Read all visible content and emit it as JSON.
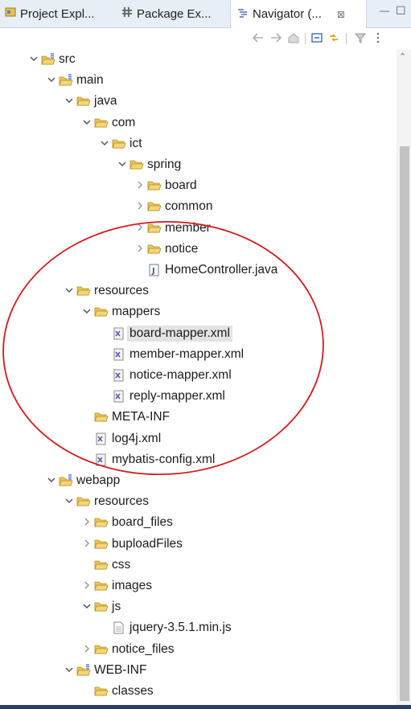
{
  "tabs": [
    {
      "label": "Project Expl...",
      "icon": "project-explorer-icon"
    },
    {
      "label": "Package Ex...",
      "icon": "package-explorer-icon"
    },
    {
      "label": "Navigator (...",
      "icon": "navigator-icon",
      "close": "⊠"
    }
  ],
  "window_controls": {
    "minimize": "—",
    "maximize": "☐"
  },
  "toolbar": [
    "back-icon",
    "forward-icon",
    "home-icon",
    "collapse-all-icon",
    "link-editor-icon",
    "filter-icon",
    "view-menu-icon"
  ],
  "tree": [
    {
      "label": "src",
      "type": "src-folder",
      "depth": 0,
      "twisty": "v"
    },
    {
      "label": "main",
      "type": "src-folder",
      "depth": 1,
      "twisty": "v"
    },
    {
      "label": "java",
      "type": "folder",
      "depth": 2,
      "twisty": "v"
    },
    {
      "label": "com",
      "type": "folder",
      "depth": 3,
      "twisty": "v"
    },
    {
      "label": "ict",
      "type": "folder",
      "depth": 4,
      "twisty": "v"
    },
    {
      "label": "spring",
      "type": "folder",
      "depth": 5,
      "twisty": "v"
    },
    {
      "label": "board",
      "type": "folder",
      "depth": 6,
      "twisty": ">"
    },
    {
      "label": "common",
      "type": "folder",
      "depth": 6,
      "twisty": ">"
    },
    {
      "label": "member",
      "type": "folder",
      "depth": 6,
      "twisty": ">"
    },
    {
      "label": "notice",
      "type": "folder",
      "depth": 6,
      "twisty": ">"
    },
    {
      "label": "HomeController.java",
      "type": "java",
      "depth": 6,
      "twisty": ""
    },
    {
      "label": "resources",
      "type": "folder",
      "depth": 2,
      "twisty": "v"
    },
    {
      "label": "mappers",
      "type": "folder",
      "depth": 3,
      "twisty": "v"
    },
    {
      "label": "board-mapper.xml",
      "type": "xml",
      "depth": 4,
      "twisty": "",
      "selected": true
    },
    {
      "label": "member-mapper.xml",
      "type": "xml",
      "depth": 4,
      "twisty": ""
    },
    {
      "label": "notice-mapper.xml",
      "type": "xml",
      "depth": 4,
      "twisty": ""
    },
    {
      "label": "reply-mapper.xml",
      "type": "xml",
      "depth": 4,
      "twisty": ""
    },
    {
      "label": "META-INF",
      "type": "folder",
      "depth": 3,
      "twisty": ""
    },
    {
      "label": "log4j.xml",
      "type": "xml",
      "depth": 3,
      "twisty": ""
    },
    {
      "label": "mybatis-config.xml",
      "type": "xml",
      "depth": 3,
      "twisty": ""
    },
    {
      "label": "webapp",
      "type": "src-folder",
      "depth": 1,
      "twisty": "v"
    },
    {
      "label": "resources",
      "type": "folder",
      "depth": 2,
      "twisty": "v"
    },
    {
      "label": "board_files",
      "type": "folder",
      "depth": 3,
      "twisty": ">"
    },
    {
      "label": "buploadFiles",
      "type": "folder",
      "depth": 3,
      "twisty": ">"
    },
    {
      "label": "css",
      "type": "folder",
      "depth": 3,
      "twisty": ""
    },
    {
      "label": "images",
      "type": "folder",
      "depth": 3,
      "twisty": ">"
    },
    {
      "label": "js",
      "type": "folder",
      "depth": 3,
      "twisty": "v"
    },
    {
      "label": "jquery-3.5.1.min.js",
      "type": "js",
      "depth": 4,
      "twisty": ""
    },
    {
      "label": "notice_files",
      "type": "folder",
      "depth": 3,
      "twisty": ">"
    },
    {
      "label": "WEB-INF",
      "type": "src-folder",
      "depth": 2,
      "twisty": "v"
    },
    {
      "label": "classes",
      "type": "folder",
      "depth": 3,
      "twisty": ""
    }
  ],
  "colors": {
    "annotation": "#d11a1a",
    "folder": "#e3b341",
    "tabbar": "#e8eef6"
  }
}
